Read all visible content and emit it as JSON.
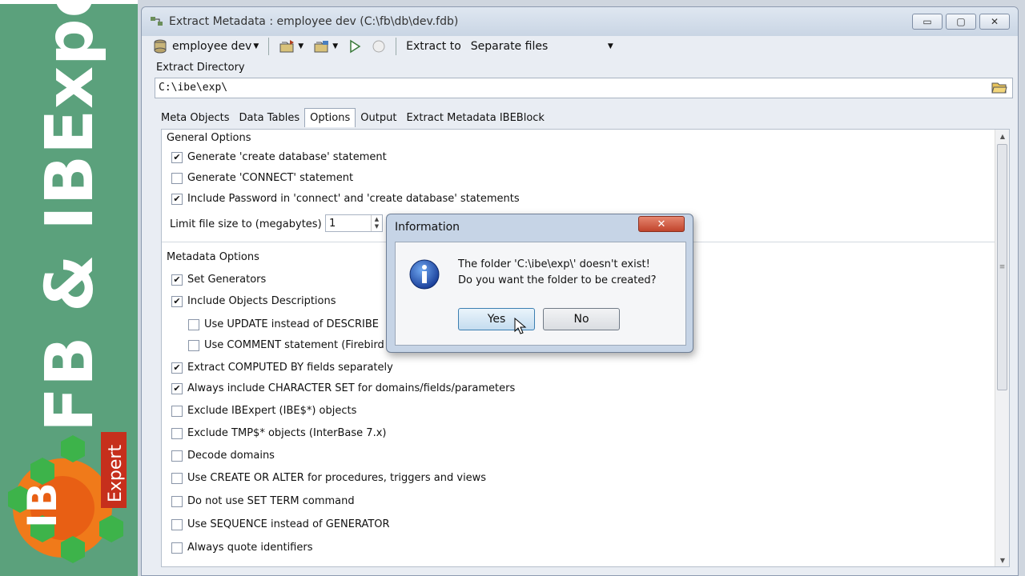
{
  "brand": {
    "vertical_title": "FB & IBExpert",
    "logo_letters": "IB",
    "logo_word": "Expert"
  },
  "window": {
    "title": "Extract Metadata : employee dev (C:\\fb\\db\\dev.fdb)",
    "controls": {
      "minimize": "▭",
      "maximize": "▢",
      "close": "✕"
    }
  },
  "toolbar": {
    "database_label": "employee dev",
    "extract_to_label": "Extract to",
    "extract_to_value": "Separate files"
  },
  "extract_directory": {
    "label": "Extract Directory",
    "value": "C:\\ibe\\exp\\"
  },
  "tabs": [
    {
      "label": "Meta Objects"
    },
    {
      "label": "Data Tables"
    },
    {
      "label": "Options",
      "active": true
    },
    {
      "label": "Output"
    },
    {
      "label": "Extract Metadata IBEBlock"
    }
  ],
  "general_options": {
    "title": "General Options",
    "items": [
      {
        "label": "Generate 'create database' statement",
        "checked": true
      },
      {
        "label": "Generate 'CONNECT' statement",
        "checked": false
      },
      {
        "label": "Include Password in 'connect' and 'create database' statements",
        "checked": true
      }
    ],
    "limit_label": "Limit file size to (megabytes)",
    "limit_value": "1"
  },
  "metadata_options": {
    "title": "Metadata Options",
    "items": [
      {
        "label": "Set Generators",
        "checked": true
      },
      {
        "label": "Include Objects Descriptions",
        "checked": true
      },
      {
        "label": "Use UPDATE instead of DESCRIBE",
        "checked": false
      },
      {
        "label": "Use COMMENT statement (Firebird 2",
        "checked": false
      },
      {
        "label": "Extract COMPUTED BY fields separately",
        "checked": true
      },
      {
        "label": "Always include CHARACTER SET for domains/fields/parameters",
        "checked": true
      },
      {
        "label": "Exclude IBExpert (IBE$*) objects",
        "checked": false
      },
      {
        "label": "Exclude TMP$* objects (InterBase 7.x)",
        "checked": false
      },
      {
        "label": "Decode domains",
        "checked": false
      },
      {
        "label": "Use CREATE OR ALTER for procedures, triggers and views",
        "checked": false
      },
      {
        "label": "Do not use SET TERM command",
        "checked": false
      },
      {
        "label": "Use SEQUENCE instead of GENERATOR",
        "checked": false
      },
      {
        "label": "Always quote identifiers",
        "checked": false
      }
    ]
  },
  "dialog": {
    "title": "Information",
    "close": "✕",
    "line1": "The folder 'C:\\ibe\\exp\\' doesn't exist!",
    "line2": "Do you want the folder to be created?",
    "yes": "Yes",
    "no": "No"
  },
  "colors": {
    "brand_green": "#5ba17c",
    "logo_orange": "#f07a1a",
    "logo_green": "#3db34a"
  }
}
